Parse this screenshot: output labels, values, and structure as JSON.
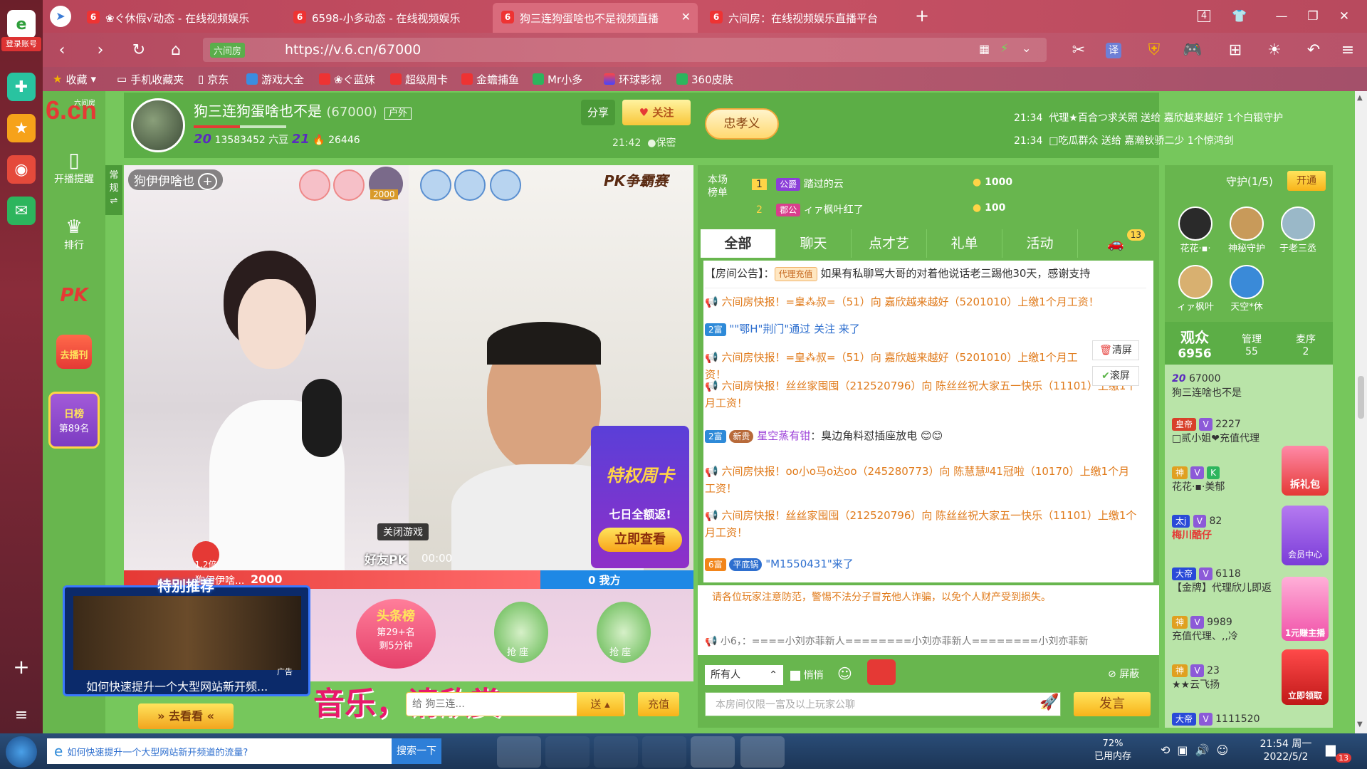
{
  "browser": {
    "tabs": [
      {
        "label": "❀ぐ休假√动态 - 在线视频娱乐",
        "icon": "6"
      },
      {
        "label": "6598-小多动态 - 在线视频娱乐",
        "icon": "6"
      },
      {
        "label": "狗三连狗蛋啥也不是视频直播",
        "icon": "6",
        "active": true
      },
      {
        "label": "六间房：在线视频娱乐直播平台",
        "icon": "6"
      }
    ],
    "new_tab": "+",
    "login_label": "登录账号",
    "url_site_name": "六间房",
    "url": "https://v.6.cn/67000",
    "tab_count": "4",
    "translate_label": "译",
    "bookmarks": [
      "收藏",
      "手机收藏夹",
      "京东",
      "游戏大全",
      "❀ぐ蓝妹",
      "超级周卡",
      "金蟾捕鱼",
      "Mr小多",
      "环球影视",
      "360皮肤"
    ]
  },
  "site": {
    "logo": "6.cn",
    "logo_sub": "六间房",
    "side_items": [
      {
        "label": "开播提醒",
        "icon": "phone-icon"
      },
      {
        "label": "排行",
        "icon": "crown-icon"
      },
      {
        "label": "PK",
        "icon": "pk-icon"
      },
      {
        "label": "去播刊",
        "icon": "broadcast-icon"
      },
      {
        "label": "日榜",
        "sub": "第89名",
        "icon": "daily-rank-icon"
      }
    ]
  },
  "room": {
    "title": "狗三连狗蛋啥也不是",
    "room_id": "(67000)",
    "tag": "户外",
    "level_left": "20",
    "beans": "13583452 六豆",
    "level_right": "21",
    "fans": "26446",
    "share": "分享",
    "follow": "关注",
    "time": "21:42",
    "secret": "保密",
    "badge_name": "忠孝义"
  },
  "ticker": [
    {
      "time": "21:34",
      "text": "代理★百合つ求关照 送给 嘉欣越来越好 1个白银守护"
    },
    {
      "time": "21:34",
      "text": "□吃瓜群众 送给 嘉瀚钬骄二少 1个惊鸿剑"
    }
  ],
  "video": {
    "mode_label": "常规",
    "streamer_tag": "狗伊伊啥也",
    "mvp_value": "2000",
    "pk_label": "PK争霸赛",
    "close_game": "关闭游戏",
    "friend_pk": "好友PK",
    "pk_timer": "00:00",
    "multiplier": "1.2倍",
    "left_score_name": "狗伊伊啥...",
    "left_score": "2000",
    "right_score": "0 我方",
    "promo_title": "特权周卡",
    "promo_sub": "七日全额返!",
    "promo_btn": "立即查看",
    "headline_title": "头条榜",
    "headline_rank": "第29+名",
    "headline_time": "剩5分钟",
    "seat_label": "抢 座",
    "banner_text": "音乐，请欣赏",
    "gift_to": "给 狗三连...",
    "send": "送",
    "recharge": "充值"
  },
  "ad": {
    "title": "特别推荐",
    "tag": "广告",
    "caption": "如何快速提升一个大型网站新开频...",
    "button": "去看看"
  },
  "rank": {
    "label": "本场榜单",
    "rows": [
      {
        "pos": "1",
        "badge": "公爵",
        "name": "踏过的云",
        "score": "1000"
      },
      {
        "pos": "2",
        "badge": "郡公",
        "name": "ィァ枫叶红了",
        "score": "100"
      }
    ]
  },
  "chat": {
    "tabs": [
      "全部",
      "聊天",
      "点才艺",
      "礼单",
      "活动",
      ""
    ],
    "car_count": "13",
    "notice_label": "【房间公告】：",
    "notice_tag": "代理充值",
    "notice_text": "如果有私聊骂大哥的对着他说话老三踢他30天，感谢支持",
    "clear": "清屏",
    "scroll": "滚屏",
    "messages": [
      {
        "type": "sys",
        "text": "六间房快报！=皇⁂叔=（51）向 嘉欣越来越好（5201010）上缴1个月工资！"
      },
      {
        "type": "enter",
        "level": "2富",
        "text": "\"\"鄂H\"荆门\"通过 关注 来了"
      },
      {
        "type": "sys",
        "text": "六间房快报！=皇⁂叔=（51）向 嘉欣越来越好（5201010）上缴1个月工资！"
      },
      {
        "type": "sys",
        "text": "六间房快报！丝丝家囤囤（212520796）向 陈丝丝祝大家五一快乐（11101）上缴1个月工资！"
      },
      {
        "type": "chat",
        "level": "2富",
        "badge": "新贵",
        "name": "星空蒸有钳",
        "text": "：臭边角料怼插座放电"
      },
      {
        "type": "sys",
        "text": "六间房快报！oo小o马o达oo（245280773）向 陈慧慧ᴶᴶ41冠啦（10170）上缴1个月工资！"
      },
      {
        "type": "sys",
        "text": "六间房快报！丝丝家囤囤（212520796）向 陈丝丝祝大家五一快乐（11101）上缴1个月工资！"
      },
      {
        "type": "enter",
        "level": "6富",
        "badge": "平底锅",
        "text": "\"M1550431\"来了"
      }
    ],
    "warning": "请各位玩家注意防范，警惕不法分子冒充他人诈骗，以免个人财产受到损失。",
    "bottom_msg": "小6，：====小刘亦菲新人========小刘亦菲新人========小刘亦菲新",
    "target": "所有人",
    "whisper": "悄悄",
    "block": "屏蔽",
    "input_placeholder": "本房间仅限一富及以上玩家公聊",
    "send": "发言"
  },
  "guard": {
    "title": "守护(1/5)",
    "open": "开通",
    "members": [
      "花花·▪·",
      "神秘守护",
      "于老三丞",
      "ィァ枫叶",
      "天空*休"
    ]
  },
  "audience": {
    "label": "观众",
    "count": "6956",
    "admin_label": "管理",
    "admin_count": "55",
    "mic_label": "麦序",
    "mic_count": "2",
    "list": [
      {
        "level": "20",
        "id": "67000",
        "name": "狗三连啥也不是"
      },
      {
        "rank": "皇帝",
        "v": "2227",
        "name": "□贰小姐❤充值代理"
      },
      {
        "rank": "神",
        "name": "花花·▪·美郁"
      },
      {
        "rank": "太j",
        "v": "82",
        "name": "梅川酷仔"
      },
      {
        "rank": "大帝",
        "v": "6118",
        "name": "【金牌】代理欣儿即返"
      },
      {
        "rank": "神",
        "v": "9989",
        "name": "充值代理、,,冷"
      },
      {
        "rank": "神",
        "v": "23",
        "name": "★★云飞扬"
      },
      {
        "rank": "大帝",
        "v": "1111520",
        "name": ""
      }
    ],
    "side_promos": [
      "拆礼包",
      "会员中心",
      "1元赚主播",
      "立即领取"
    ]
  },
  "taskbar": {
    "search_text": "如何快速提升一个大型网站新开频道的流量?",
    "search_btn": "搜索一下",
    "memory": "72%",
    "memory_label": "已用内存",
    "time": "21:54 周一",
    "date": "2022/5/2",
    "notif": "13"
  }
}
